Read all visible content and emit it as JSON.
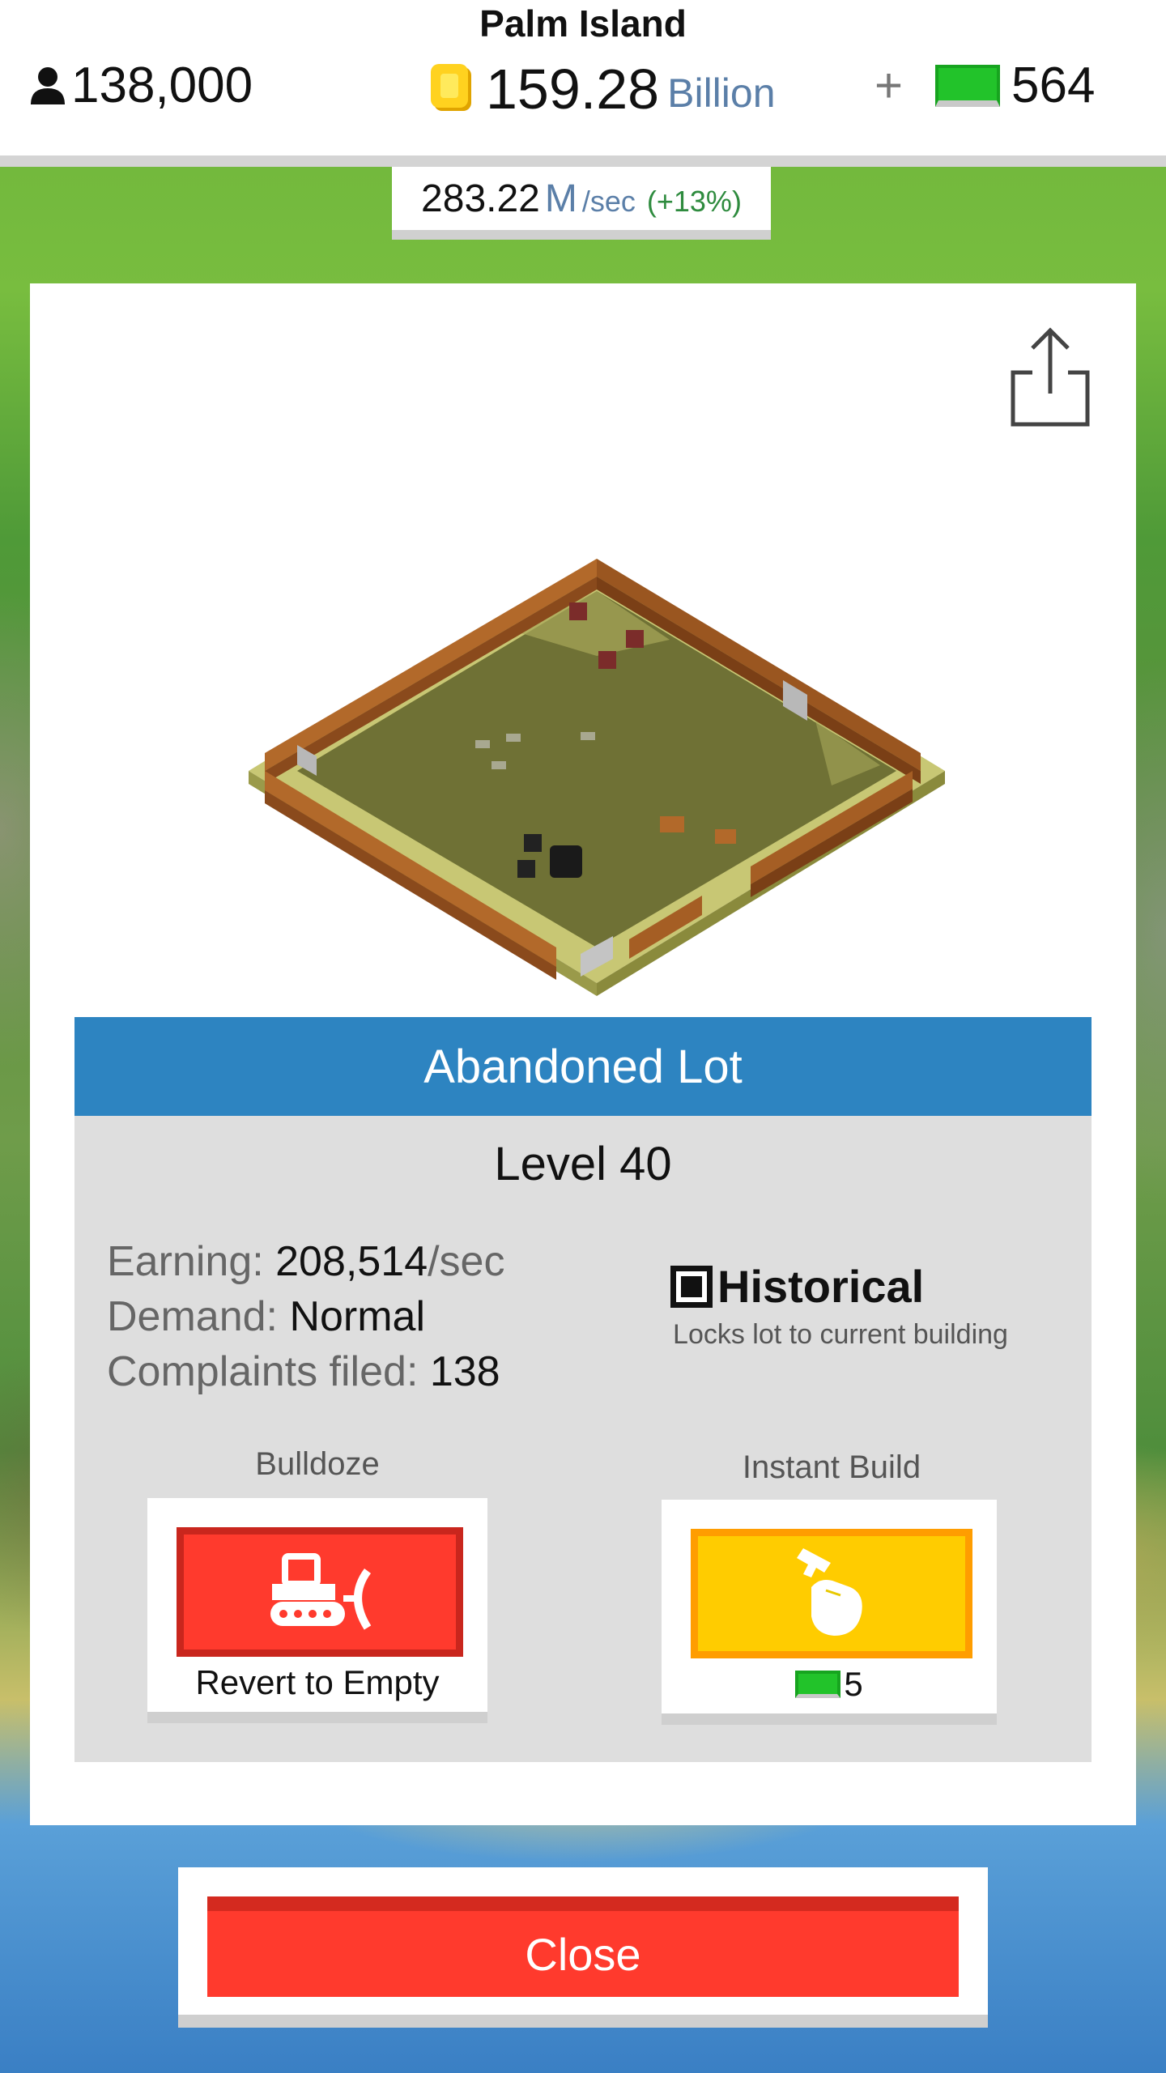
{
  "hud": {
    "island_name": "Palm Island",
    "population": "138,000",
    "coins": {
      "value": "159.28",
      "unit": "Billion"
    },
    "cash": {
      "plus": "+",
      "value": "564"
    },
    "rate": {
      "value": "283.22",
      "unit": "M",
      "per": "/sec",
      "change": "(+13%)"
    }
  },
  "panel": {
    "share_icon": "share-icon",
    "title": "Abandoned Lot",
    "level": "Level 40",
    "stats": [
      {
        "label": "Earning: ",
        "value": "208,514",
        "suffix": "/sec"
      },
      {
        "label": "Demand: ",
        "value": "Normal"
      },
      {
        "label": "Complaints filed: ",
        "value": "138"
      }
    ],
    "historical": {
      "label": "Historical",
      "description": "Locks lot to current building",
      "checked": true
    },
    "bulldoze": {
      "label": "Bulldoze",
      "caption": "Revert to Empty",
      "icon": "bulldozer-icon"
    },
    "instant_build": {
      "label": "Instant Build",
      "cost": "5",
      "icon": "hammer-hand-icon"
    }
  },
  "close_label": "Close",
  "colors": {
    "title_bar": "#2d84c1",
    "bulldoze_red": "#ff3a2d",
    "build_yellow": "#ffcc00",
    "cash_green": "#22c32a"
  }
}
